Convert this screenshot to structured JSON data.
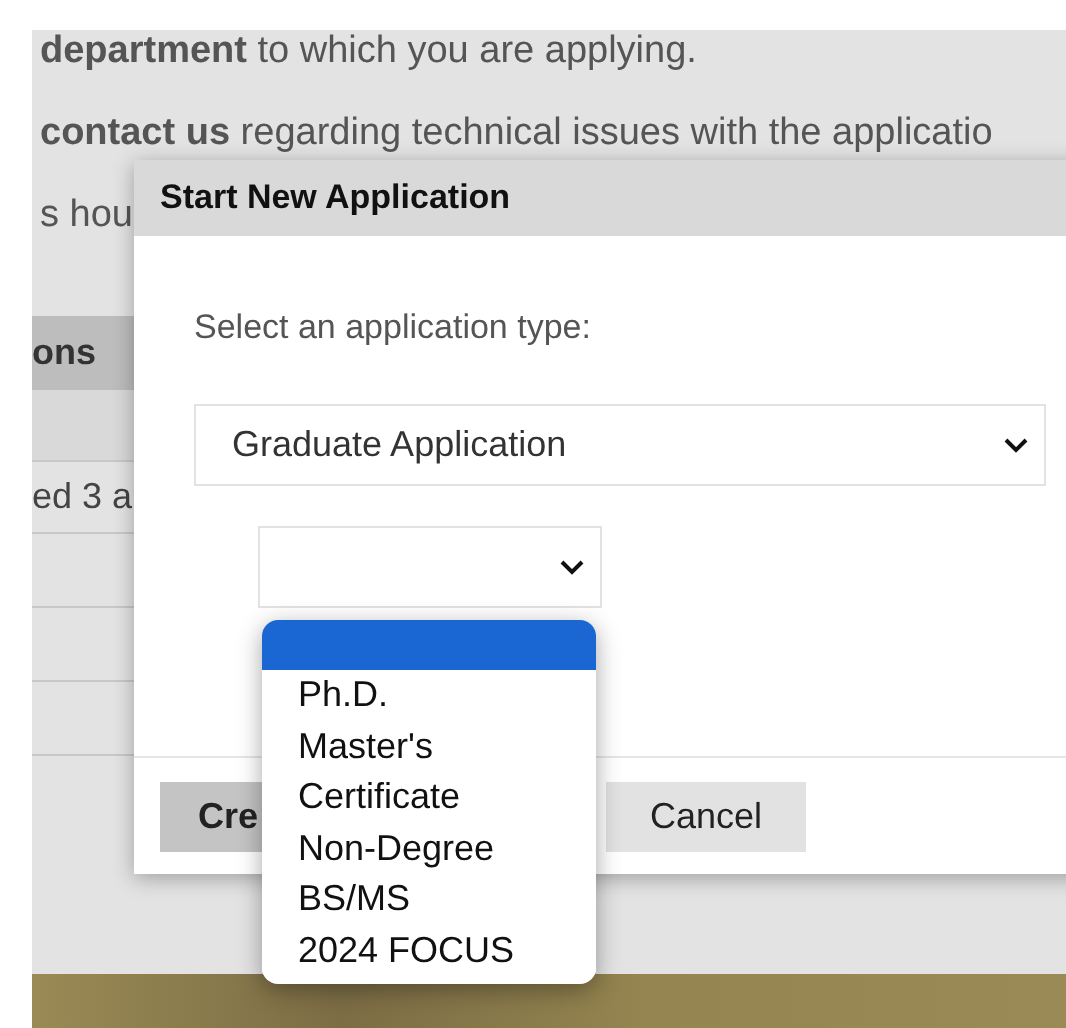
{
  "background": {
    "intro_line": "**department** to which you are applying.",
    "contact_line": "**contact us** regarding technical issues with the applicatio",
    "hours_line": "s hou",
    "table": {
      "header": "ons",
      "rows": [
        {
          "cell": ""
        },
        {
          "cell": "ed 3 a"
        }
      ]
    }
  },
  "dialog": {
    "title": "Start New Application",
    "prompt": "Select an application type:",
    "type_select": {
      "value": "Graduate Application"
    },
    "subtype_select": {
      "options": [
        {
          "kind": "blank",
          "selected": true
        },
        {
          "kind": "text",
          "label": "Ph.D.",
          "selected": false
        },
        {
          "kind": "text",
          "label": "Master's",
          "selected": false
        },
        {
          "kind": "text",
          "label": "Certificate",
          "selected": false
        },
        {
          "kind": "text",
          "label": "Non-Degree",
          "selected": false
        },
        {
          "kind": "text",
          "label": "BS/MS",
          "selected": false
        },
        {
          "kind": "text",
          "label": "2024 FOCUS",
          "selected": false
        }
      ]
    },
    "buttons": [
      {
        "kind": "primary",
        "label": "Cre"
      },
      {
        "kind": "secondary",
        "label": "Cancel"
      }
    ]
  }
}
